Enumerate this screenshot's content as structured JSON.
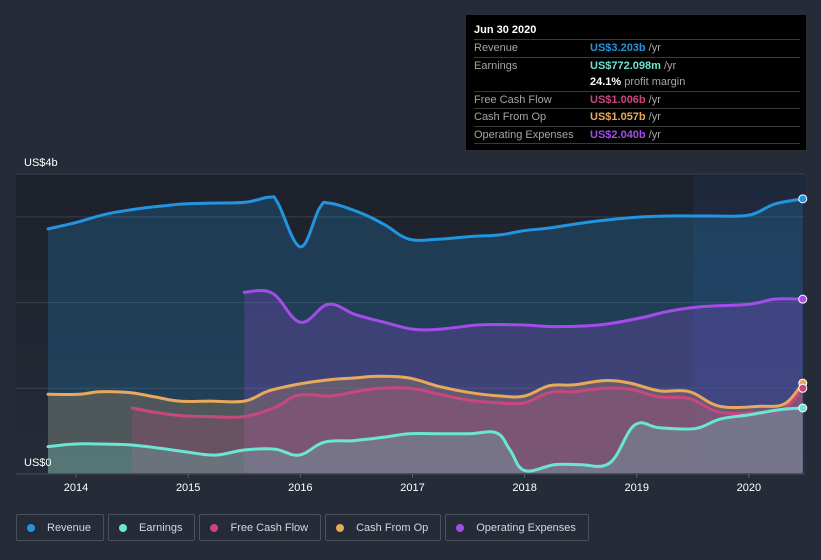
{
  "tooltip": {
    "date": "Jun 30 2020",
    "rows": [
      {
        "label": "Revenue",
        "value": "US$3.203b",
        "unit": "/yr",
        "color": "#2394df"
      },
      {
        "label": "Earnings",
        "value": "US$772.098m",
        "unit": "/yr",
        "color": "#6ce5d3"
      },
      {
        "label": "",
        "value": "24.1%",
        "unit": "profit margin",
        "color": "#ffffff"
      },
      {
        "label": "Free Cash Flow",
        "value": "US$1.006b",
        "unit": "/yr",
        "color": "#c9477f"
      },
      {
        "label": "Cash From Op",
        "value": "US$1.057b",
        "unit": "/yr",
        "color": "#e8a95a"
      },
      {
        "label": "Operating Expenses",
        "value": "US$2.040b",
        "unit": "/yr",
        "color": "#a34de8"
      }
    ]
  },
  "chart_data": {
    "type": "area",
    "title": "",
    "xlabel": "",
    "ylabel": "",
    "y_top_label": "US$4b",
    "y_bottom_label": "US$0",
    "ylim": [
      0,
      3.5
    ],
    "xlim": [
      2013.75,
      2020.5
    ],
    "x_ticks": [
      2014,
      2015,
      2016,
      2017,
      2018,
      2019,
      2020
    ],
    "y_gridlines": [
      1,
      2,
      3,
      3.5
    ],
    "highlight_from": 2019.5,
    "unit": "US$ billions",
    "series": [
      {
        "name": "Revenue",
        "color": "#2394df",
        "points": [
          [
            2013.75,
            2.86
          ],
          [
            2013.99,
            2.93
          ],
          [
            2014.26,
            3.03
          ],
          [
            2014.53,
            3.09
          ],
          [
            2014.79,
            3.13
          ],
          [
            2014.95,
            3.15
          ],
          [
            2015.2,
            3.16
          ],
          [
            2015.51,
            3.17
          ],
          [
            2015.73,
            3.23
          ],
          [
            2015.8,
            3.16
          ],
          [
            2016.0,
            2.65
          ],
          [
            2016.17,
            3.1
          ],
          [
            2016.26,
            3.16
          ],
          [
            2016.53,
            3.05
          ],
          [
            2016.75,
            2.91
          ],
          [
            2016.97,
            2.74
          ],
          [
            2017.24,
            2.74
          ],
          [
            2017.51,
            2.77
          ],
          [
            2017.78,
            2.79
          ],
          [
            2018.0,
            2.84
          ],
          [
            2018.22,
            2.87
          ],
          [
            2018.58,
            2.94
          ],
          [
            2018.94,
            2.99
          ],
          [
            2019.29,
            3.01
          ],
          [
            2019.65,
            3.01
          ],
          [
            2020.0,
            3.02
          ],
          [
            2020.23,
            3.15
          ],
          [
            2020.48,
            3.21
          ]
        ]
      },
      {
        "name": "Operating Expenses",
        "color": "#a34de8",
        "points": [
          [
            2015.5,
            2.12
          ],
          [
            2015.75,
            2.11
          ],
          [
            2016.0,
            1.77
          ],
          [
            2016.25,
            1.98
          ],
          [
            2016.49,
            1.86
          ],
          [
            2016.75,
            1.77
          ],
          [
            2017.0,
            1.69
          ],
          [
            2017.25,
            1.69
          ],
          [
            2017.6,
            1.74
          ],
          [
            2017.96,
            1.74
          ],
          [
            2018.27,
            1.72
          ],
          [
            2018.67,
            1.74
          ],
          [
            2019.03,
            1.82
          ],
          [
            2019.29,
            1.9
          ],
          [
            2019.56,
            1.95
          ],
          [
            2020.0,
            1.98
          ],
          [
            2020.23,
            2.04
          ],
          [
            2020.48,
            2.04
          ]
        ]
      },
      {
        "name": "Cash From Op",
        "color": "#e8a95a",
        "points": [
          [
            2013.75,
            0.93
          ],
          [
            2014.03,
            0.93
          ],
          [
            2014.21,
            0.96
          ],
          [
            2014.48,
            0.95
          ],
          [
            2014.7,
            0.9
          ],
          [
            2014.92,
            0.85
          ],
          [
            2015.19,
            0.85
          ],
          [
            2015.5,
            0.85
          ],
          [
            2015.72,
            0.97
          ],
          [
            2015.99,
            1.05
          ],
          [
            2016.26,
            1.1
          ],
          [
            2016.48,
            1.12
          ],
          [
            2016.7,
            1.14
          ],
          [
            2016.97,
            1.12
          ],
          [
            2017.24,
            1.02
          ],
          [
            2017.51,
            0.95
          ],
          [
            2017.78,
            0.91
          ],
          [
            2018.0,
            0.91
          ],
          [
            2018.22,
            1.03
          ],
          [
            2018.44,
            1.04
          ],
          [
            2018.71,
            1.09
          ],
          [
            2018.94,
            1.06
          ],
          [
            2019.2,
            0.97
          ],
          [
            2019.47,
            0.96
          ],
          [
            2019.74,
            0.79
          ],
          [
            2020.1,
            0.79
          ],
          [
            2020.32,
            0.82
          ],
          [
            2020.48,
            1.06
          ]
        ]
      },
      {
        "name": "Free Cash Flow",
        "color": "#c9477f",
        "points": [
          [
            2014.5,
            0.77
          ],
          [
            2014.75,
            0.71
          ],
          [
            2014.95,
            0.68
          ],
          [
            2015.2,
            0.67
          ],
          [
            2015.5,
            0.67
          ],
          [
            2015.78,
            0.78
          ],
          [
            2015.98,
            0.92
          ],
          [
            2016.26,
            0.91
          ],
          [
            2016.49,
            0.96
          ],
          [
            2016.71,
            1.0
          ],
          [
            2016.98,
            1.0
          ],
          [
            2017.24,
            0.93
          ],
          [
            2017.51,
            0.86
          ],
          [
            2017.78,
            0.83
          ],
          [
            2018.0,
            0.83
          ],
          [
            2018.22,
            0.95
          ],
          [
            2018.44,
            0.96
          ],
          [
            2018.71,
            1.0
          ],
          [
            2018.94,
            0.99
          ],
          [
            2019.2,
            0.9
          ],
          [
            2019.47,
            0.88
          ],
          [
            2019.74,
            0.72
          ],
          [
            2020.1,
            0.72
          ],
          [
            2020.32,
            0.77
          ],
          [
            2020.48,
            1.0
          ]
        ]
      },
      {
        "name": "Earnings",
        "color": "#6ce5d3",
        "points": [
          [
            2013.75,
            0.32
          ],
          [
            2013.99,
            0.35
          ],
          [
            2014.21,
            0.35
          ],
          [
            2014.48,
            0.34
          ],
          [
            2014.75,
            0.3
          ],
          [
            2014.97,
            0.26
          ],
          [
            2015.24,
            0.22
          ],
          [
            2015.5,
            0.28
          ],
          [
            2015.77,
            0.29
          ],
          [
            2015.99,
            0.22
          ],
          [
            2016.21,
            0.37
          ],
          [
            2016.48,
            0.39
          ],
          [
            2016.75,
            0.43
          ],
          [
            2016.97,
            0.47
          ],
          [
            2017.24,
            0.47
          ],
          [
            2017.51,
            0.47
          ],
          [
            2017.75,
            0.48
          ],
          [
            2017.87,
            0.28
          ],
          [
            2018.0,
            0.04
          ],
          [
            2018.27,
            0.11
          ],
          [
            2018.49,
            0.11
          ],
          [
            2018.76,
            0.13
          ],
          [
            2018.98,
            0.57
          ],
          [
            2019.2,
            0.54
          ],
          [
            2019.52,
            0.53
          ],
          [
            2019.74,
            0.64
          ],
          [
            2020.0,
            0.69
          ],
          [
            2020.27,
            0.75
          ],
          [
            2020.48,
            0.77
          ]
        ]
      }
    ]
  },
  "legend": [
    {
      "label": "Revenue",
      "color": "#2394df"
    },
    {
      "label": "Earnings",
      "color": "#6ce5d3"
    },
    {
      "label": "Free Cash Flow",
      "color": "#c9477f"
    },
    {
      "label": "Cash From Op",
      "color": "#e8a95a"
    },
    {
      "label": "Operating Expenses",
      "color": "#a34de8"
    }
  ]
}
